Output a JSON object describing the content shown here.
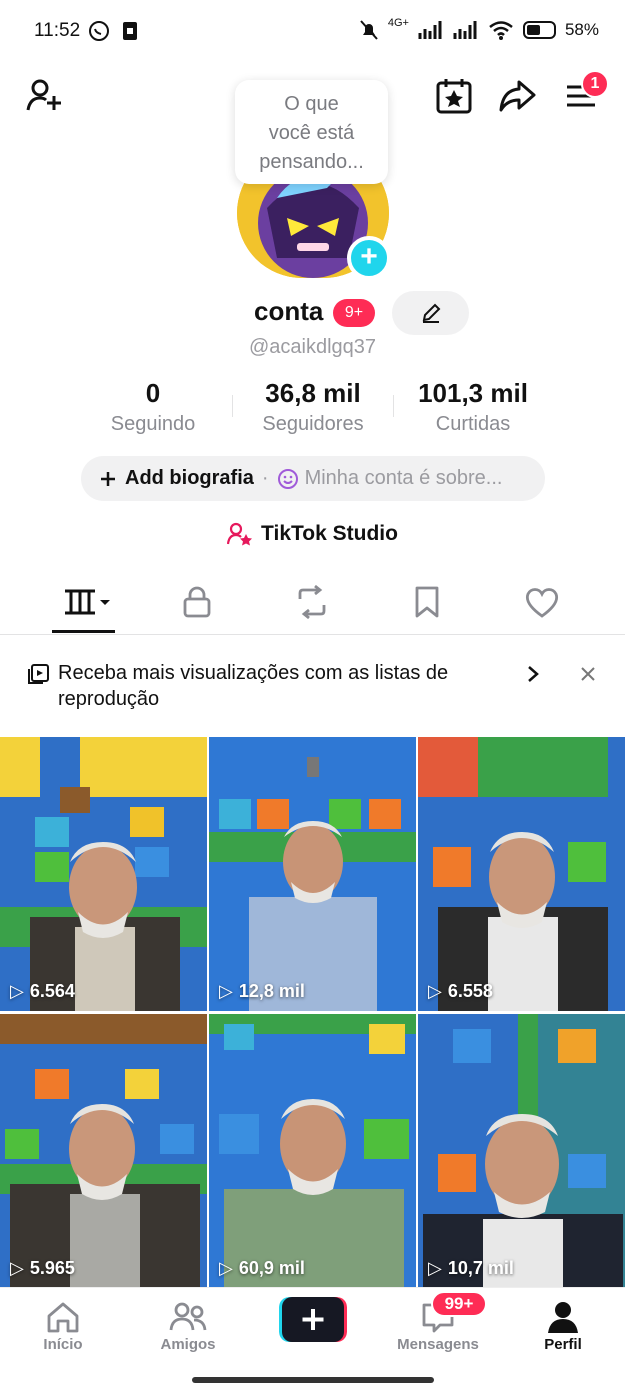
{
  "status_bar": {
    "time": "11:52",
    "network": "4G+",
    "battery_percent": "58%",
    "battery_level": 0.58,
    "icons": [
      "whatsapp-icon",
      "sim-icon",
      "mute-icon",
      "signal-icon",
      "signal-icon",
      "wifi-icon",
      "battery-icon"
    ]
  },
  "top_bar": {
    "icons": [
      "add-friend-icon",
      "calendar-star-icon",
      "share-icon",
      "menu-icon"
    ],
    "menu_badge": "1"
  },
  "profile": {
    "thought_bubble": [
      "O que",
      "você está",
      "pensando..."
    ],
    "name": "conta",
    "name_badge": "9+",
    "handle": "@acaikdlgq37",
    "stats": [
      {
        "value": "0",
        "label": "Seguindo"
      },
      {
        "value": "36,8 mil",
        "label": "Seguidores"
      },
      {
        "value": "101,3 mil",
        "label": "Curtidas"
      }
    ],
    "bio_add": "Add biografia",
    "bio_separator": "·",
    "bio_hint": "Minha conta é sobre...",
    "studio_label": "TikTok Studio"
  },
  "tabs": [
    "videos-grid-icon",
    "lock-icon",
    "repost-icon",
    "bookmark-icon",
    "heart-icon"
  ],
  "banner": {
    "text": "Receba mais visualizações com as listas de reprodução"
  },
  "videos": [
    {
      "views": "6.564"
    },
    {
      "views": "12,8 mil"
    },
    {
      "views": "6.558"
    },
    {
      "views": "5.965"
    },
    {
      "views": "60,9 mil"
    },
    {
      "views": "10,7 mil"
    }
  ],
  "bottom_nav": {
    "items": [
      {
        "label": "Início"
      },
      {
        "label": "Amigos"
      },
      {
        "label": ""
      },
      {
        "label": "Mensagens"
      },
      {
        "label": "Perfil"
      }
    ],
    "messages_badge": "99+"
  },
  "colors": {
    "accent_red": "#fe2c55",
    "accent_cyan": "#20d5ec",
    "text": "#161823",
    "secondary_text": "#8a8b91"
  }
}
